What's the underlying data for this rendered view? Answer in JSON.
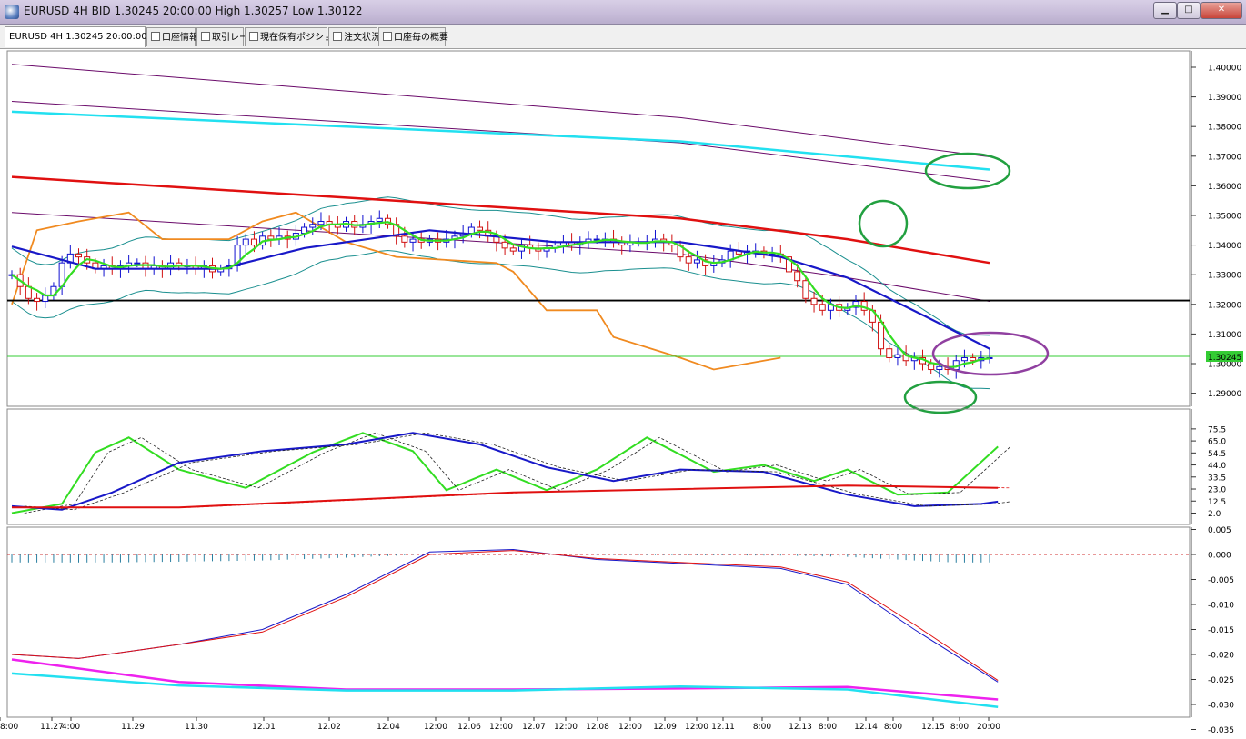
{
  "window": {
    "title": "EURUSD 4H BID 1.30245 20:00:00 High 1.30257 Low 1.30122",
    "controls": {
      "minimize": "▁",
      "maximize": "□",
      "close": "✕"
    }
  },
  "tabs": [
    {
      "label": "EURUSD 4H 1.30245 20:00:00",
      "checkbox": false
    },
    {
      "label": "口座情報",
      "checkbox": true
    },
    {
      "label": "取引レート",
      "checkbox": true
    },
    {
      "label": "現在保有ポジション",
      "checkbox": true
    },
    {
      "label": "注文状況",
      "checkbox": true
    },
    {
      "label": "口座毎の概要",
      "checkbox": true
    }
  ],
  "price_panel": {
    "current_price_label": "1.30245",
    "y_ticks": [
      "1.40000",
      "1.39000",
      "1.38000",
      "1.37000",
      "1.36000",
      "1.35000",
      "1.34000",
      "1.33000",
      "1.32000",
      "1.31000",
      "1.30000",
      "1.29000"
    ]
  },
  "osc_panel": {
    "y_ticks": [
      "75.5",
      "65.0",
      "54.5",
      "44.0",
      "33.5",
      "23.0",
      "12.5",
      "2.0"
    ]
  },
  "macd_panel": {
    "y_ticks": [
      "0.005",
      "0.000",
      "-0.005",
      "-0.010",
      "-0.015",
      "-0.020",
      "-0.025",
      "-0.030",
      "-0.035"
    ]
  },
  "x_axis_labels": [
    "8:00",
    "11.27",
    "4:00",
    "11.29",
    "11.30",
    "12.01",
    "12.02",
    "12.04",
    "12:00",
    "12.06",
    "12:00",
    "12.07",
    "12:00",
    "12.08",
    "12:00",
    "12.09",
    "12:00",
    "12.11",
    "8:00",
    "12.13",
    "8:00",
    "12.14",
    "8:00",
    "12.15",
    "8:00",
    "20:00"
  ],
  "colors": {
    "bull_candle": "#1010d0",
    "bear_candle": "#d01010",
    "sma_red": "#e01010",
    "ma_blue": "#1818c8",
    "ma_green": "#33dd22",
    "band_teal": "#1a8f8f",
    "band_purple": "#6a0a6a",
    "cyan_line": "#22e0f0",
    "orange_line": "#f08a20",
    "horizontal_black": "#000000",
    "horizontal_green": "#33cc33",
    "annotation_green": "#22a040",
    "annotation_purple": "#9040a0",
    "macd_signal": "#e01010",
    "macd_main": "#1818c8",
    "magenta_line": "#ee22ee",
    "price_label_bg": "#33cc33"
  },
  "chart_data": [
    {
      "type": "line",
      "title": "",
      "symbol": "EURUSD",
      "timeframe": "4H",
      "bid": 1.30245,
      "high": 1.30257,
      "low": 1.30122,
      "ylim": [
        1.285,
        1.405
      ],
      "closes": [
        1.33,
        1.326,
        1.322,
        1.321,
        1.323,
        1.326,
        1.334,
        1.337,
        1.336,
        1.334,
        1.332,
        1.333,
        1.332,
        1.333,
        1.334,
        1.334,
        1.332,
        1.333,
        1.332,
        1.334,
        1.333,
        1.333,
        1.332,
        1.333,
        1.331,
        1.332,
        1.333,
        1.34,
        1.342,
        1.34,
        1.343,
        1.342,
        1.343,
        1.342,
        1.344,
        1.346,
        1.347,
        1.348,
        1.347,
        1.346,
        1.348,
        1.346,
        1.347,
        1.348,
        1.349,
        1.347,
        1.343,
        1.341,
        1.342,
        1.341,
        1.342,
        1.341,
        1.342,
        1.343,
        1.344,
        1.346,
        1.345,
        1.343,
        1.341,
        1.339,
        1.338,
        1.34,
        1.339,
        1.338,
        1.339,
        1.34,
        1.341,
        1.34,
        1.341,
        1.342,
        1.342,
        1.342,
        1.341,
        1.34,
        1.341,
        1.341,
        1.341,
        1.342,
        1.341,
        1.34,
        1.336,
        1.334,
        1.335,
        1.333,
        1.334,
        1.335,
        1.338,
        1.337,
        1.338,
        1.338,
        1.337,
        1.337,
        1.336,
        1.331,
        1.328,
        1.322,
        1.32,
        1.318,
        1.32,
        1.318,
        1.319,
        1.321,
        1.318,
        1.314,
        1.305,
        1.302,
        1.303,
        1.301,
        1.302,
        1.3,
        1.298,
        1.299,
        1.298,
        1.301,
        1.302,
        1.301,
        1.302,
        1.302
      ],
      "series": [
        {
          "name": "",
          "color": "red",
          "points": [
            [
              0,
              1.363
            ],
            [
              40,
              1.356
            ],
            [
              80,
              1.349
            ],
            [
              100,
              1.342
            ],
            [
              117,
              1.334
            ]
          ]
        },
        {
          "name": "",
          "color": "cyan",
          "points": [
            [
              0,
              1.385
            ],
            [
              40,
              1.38
            ],
            [
              80,
              1.375
            ],
            [
              117,
              1.3655
            ]
          ]
        },
        {
          "name": "",
          "color": "blue",
          "points": [
            [
              0,
              1.3395
            ],
            [
              10,
              1.332
            ],
            [
              25,
              1.332
            ],
            [
              35,
              1.339
            ],
            [
              50,
              1.345
            ],
            [
              65,
              1.341
            ],
            [
              80,
              1.341
            ],
            [
              92,
              1.336
            ],
            [
              100,
              1.329
            ],
            [
              110,
              1.315
            ],
            [
              117,
              1.305
            ]
          ]
        },
        {
          "name": "",
          "color": "orange",
          "points": [
            [
              0,
              1.32
            ],
            [
              3,
              1.345
            ],
            [
              8,
              1.348
            ],
            [
              14,
              1.351
            ],
            [
              18,
              1.342
            ],
            [
              26,
              1.342
            ],
            [
              30,
              1.348
            ],
            [
              34,
              1.351
            ],
            [
              40,
              1.341
            ],
            [
              46,
              1.336
            ],
            [
              58,
              1.334
            ],
            [
              60,
              1.331
            ],
            [
              64,
              1.318
            ],
            [
              70,
              1.318
            ],
            [
              72,
              1.309
            ],
            [
              80,
              1.302
            ],
            [
              84,
              1.298
            ],
            [
              92,
              1.302
            ]
          ]
        }
      ],
      "horizontal_lines": [
        {
          "y": 1.3213,
          "color": "black"
        },
        {
          "y": 1.30245,
          "color": "green"
        }
      ]
    },
    {
      "type": "line",
      "title": "",
      "ylim": [
        0,
        80
      ],
      "series": [
        {
          "name": "",
          "color": "green",
          "points": [
            [
              0,
              2
            ],
            [
              6,
              10
            ],
            [
              10,
              55
            ],
            [
              14,
              68
            ],
            [
              20,
              40
            ],
            [
              28,
              24
            ],
            [
              36,
              55
            ],
            [
              42,
              72
            ],
            [
              48,
              56
            ],
            [
              52,
              22
            ],
            [
              58,
              40
            ],
            [
              64,
              22
            ],
            [
              70,
              40
            ],
            [
              76,
              68
            ],
            [
              84,
              38
            ],
            [
              90,
              44
            ],
            [
              96,
              30
            ],
            [
              100,
              40
            ],
            [
              106,
              18
            ],
            [
              112,
              20
            ],
            [
              118,
              60
            ]
          ]
        },
        {
          "name": "",
          "color": "blue",
          "points": [
            [
              0,
              8
            ],
            [
              6,
              5
            ],
            [
              12,
              20
            ],
            [
              20,
              46
            ],
            [
              30,
              56
            ],
            [
              40,
              62
            ],
            [
              48,
              72
            ],
            [
              56,
              62
            ],
            [
              64,
              42
            ],
            [
              72,
              30
            ],
            [
              80,
              40
            ],
            [
              90,
              38
            ],
            [
              100,
              18
            ],
            [
              108,
              8
            ],
            [
              116,
              10
            ],
            [
              118,
              12
            ]
          ]
        },
        {
          "name": "",
          "color": "red",
          "points": [
            [
              0,
              7
            ],
            [
              20,
              7
            ],
            [
              60,
              20
            ],
            [
              100,
              26
            ],
            [
              118,
              24
            ]
          ]
        }
      ]
    },
    {
      "type": "line",
      "title": "",
      "ylim": [
        -0.035,
        0.005
      ],
      "series": [
        {
          "name": "",
          "color": "blue",
          "points": [
            [
              0,
              -0.02
            ],
            [
              8,
              -0.0208
            ],
            [
              20,
              -0.018
            ],
            [
              30,
              -0.015
            ],
            [
              40,
              -0.008
            ],
            [
              50,
              0.0005
            ],
            [
              60,
              0.001
            ],
            [
              70,
              -0.001
            ],
            [
              80,
              -0.0018
            ],
            [
              92,
              -0.0028
            ],
            [
              100,
              -0.006
            ],
            [
              108,
              -0.015
            ],
            [
              118,
              -0.0255
            ]
          ]
        },
        {
          "name": "",
          "color": "red",
          "points": [
            [
              0,
              -0.02
            ],
            [
              8,
              -0.0208
            ],
            [
              20,
              -0.018
            ],
            [
              30,
              -0.0155
            ],
            [
              40,
              -0.0085
            ],
            [
              50,
              0.0
            ],
            [
              60,
              0.0008
            ],
            [
              70,
              -0.0008
            ],
            [
              80,
              -0.0016
            ],
            [
              92,
              -0.0025
            ],
            [
              100,
              -0.0055
            ],
            [
              108,
              -0.014
            ],
            [
              118,
              -0.0252
            ]
          ]
        },
        {
          "name": "",
          "color": "magenta",
          "points": [
            [
              0,
              -0.021
            ],
            [
              20,
              -0.0255
            ],
            [
              40,
              -0.027
            ],
            [
              60,
              -0.027
            ],
            [
              80,
              -0.0268
            ],
            [
              100,
              -0.0265
            ],
            [
              118,
              -0.029
            ]
          ]
        },
        {
          "name": "",
          "color": "cyan",
          "points": [
            [
              0,
              -0.0238
            ],
            [
              20,
              -0.0262
            ],
            [
              40,
              -0.0272
            ],
            [
              60,
              -0.0272
            ],
            [
              80,
              -0.0264
            ],
            [
              100,
              -0.027
            ],
            [
              118,
              -0.0305
            ]
          ]
        }
      ]
    }
  ]
}
